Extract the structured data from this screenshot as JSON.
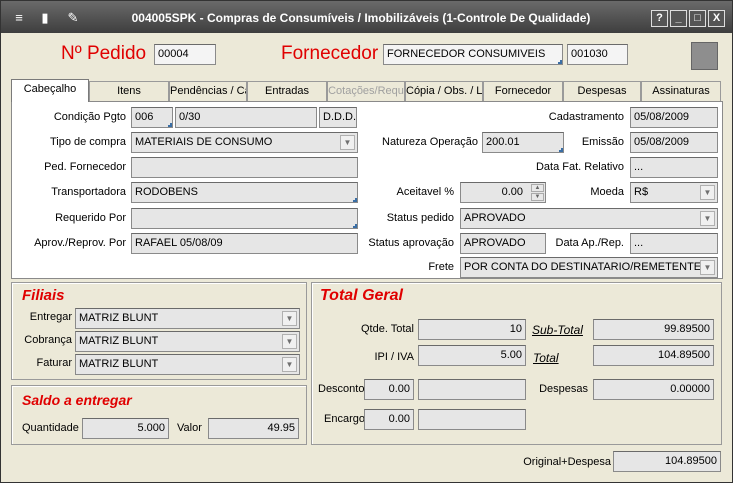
{
  "window": {
    "title": "004005SPK - Compras de Consumíveis / Imobilizáveis (1-Controle De Qualidade)",
    "buttons": {
      "help": "?",
      "minimize": "_",
      "maximize": "□",
      "close": "X"
    }
  },
  "header": {
    "pedido_label": "Nº Pedido",
    "pedido_value": "00004",
    "fornecedor_label": "Fornecedor",
    "fornecedor_name": "FORNECEDOR CONSUMIVEIS",
    "fornecedor_code": "001030"
  },
  "tabs": [
    {
      "label": "Cabeçalho"
    },
    {
      "label": "Itens"
    },
    {
      "label": "Pendências / Ca"
    },
    {
      "label": "Entradas"
    },
    {
      "label": "Cotações/Requ"
    },
    {
      "label": "Cópia / Obs. / L"
    },
    {
      "label": "Fornecedor"
    },
    {
      "label": "Despesas"
    },
    {
      "label": "Assinaturas"
    }
  ],
  "cabecalho": {
    "condicao_pgto_label": "Condição Pgto",
    "condicao_pgto_code": "006",
    "condicao_pgto_desc": "0/30",
    "condicao_pgto_ddd": "D.D.D.",
    "tipo_compra_label": "Tipo de compra",
    "tipo_compra_value": "MATERIAIS DE CONSUMO",
    "ped_fornecedor_label": "Ped. Fornecedor",
    "ped_fornecedor_value": "",
    "transportadora_label": "Transportadora",
    "transportadora_value": "RODOBENS",
    "requerido_label": "Requerido Por",
    "requerido_value": "",
    "aprov_label": "Aprov./Reprov. Por",
    "aprov_value": "RAFAEL 05/08/09",
    "cadastramento_label": "Cadastramento",
    "cadastramento_value": "05/08/2009",
    "natureza_label": "Natureza Operação",
    "natureza_value": "200.01",
    "emissao_label": "Emissão",
    "emissao_value": "05/08/2009",
    "data_fat_label": "Data Fat. Relativo",
    "data_fat_value": "...",
    "aceitavel_label": "Aceitavel %",
    "aceitavel_value": "0.00",
    "moeda_label": "Moeda",
    "moeda_value": "R$",
    "status_pedido_label": "Status pedido",
    "status_pedido_value": "APROVADO",
    "status_aprov_label": "Status aprovação",
    "status_aprov_value": "APROVADO",
    "data_ap_label": "Data Ap./Rep.",
    "data_ap_value": "...",
    "frete_label": "Frete",
    "frete_value": "POR CONTA DO DESTINATARIO/REMETENTE"
  },
  "filiais": {
    "title": "Filiais",
    "entregar_label": "Entregar",
    "entregar_value": "MATRIZ BLUNT",
    "cobranca_label": "Cobrança",
    "cobranca_value": "MATRIZ BLUNT",
    "faturar_label": "Faturar",
    "faturar_value": "MATRIZ BLUNT"
  },
  "saldo": {
    "title": "Saldo a entregar",
    "quantidade_label": "Quantidade",
    "quantidade_value": "5.000",
    "valor_label": "Valor",
    "valor_value": "49.95"
  },
  "total": {
    "title": "Total Geral",
    "qtde_label": "Qtde. Total",
    "qtde_value": "10",
    "subtotal_label": "Sub-Total",
    "subtotal_value": "99.89500",
    "ipi_label": "IPI / IVA",
    "ipi_value": "5.00",
    "total_label": "Total",
    "total_value": "104.89500",
    "desconto_label": "Desconto",
    "desconto_pct": "0.00",
    "desconto_value": "",
    "despesas_label": "Despesas",
    "despesas_value": "0.00000",
    "encargo_label": "Encargo",
    "encargo_pct": "0.00",
    "encargo_value": ""
  },
  "footer": {
    "original_label": "Original+Despesa",
    "original_value": "104.89500"
  },
  "colors": {
    "accent_red": "#e00000",
    "titlebar": "#4a4a4a"
  }
}
